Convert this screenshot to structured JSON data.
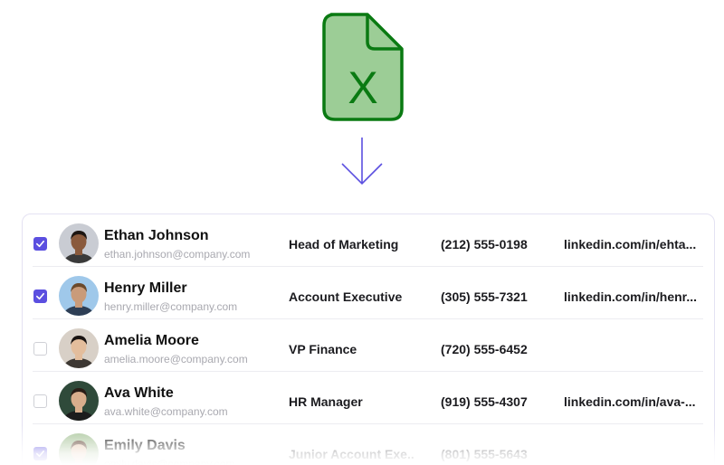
{
  "icons": {
    "file": "excel-file-icon",
    "arrow": "arrow-down-icon",
    "file_letter": "X"
  },
  "colors": {
    "accent": "#5b4fe0",
    "excel_green": "#0a7a12",
    "excel_fill": "#9ccd96"
  },
  "contacts": [
    {
      "checked": true,
      "name": "Ethan Johnson",
      "email": "ethan.johnson@company.com",
      "role": "Head of Marketing",
      "phone": "(212) 555-0198",
      "linkedin": "linkedin.com/in/ehta..."
    },
    {
      "checked": true,
      "name": "Henry Miller",
      "email": "henry.miller@company.com",
      "role": "Account Executive",
      "phone": "(305) 555-7321",
      "linkedin": "linkedin.com/in/henr..."
    },
    {
      "checked": false,
      "name": "Amelia Moore",
      "email": "amelia.moore@company.com",
      "role": "VP Finance",
      "phone": "(720) 555-6452",
      "linkedin": ""
    },
    {
      "checked": false,
      "name": "Ava White",
      "email": "ava.white@company.com",
      "role": "HR Manager",
      "phone": "(919) 555-4307",
      "linkedin": "linkedin.com/in/ava-..."
    },
    {
      "checked": true,
      "name": "Emily Davis",
      "email": "emily.davis@company.com",
      "role": "Junior Account Exe..",
      "phone": "(801) 555-5643",
      "linkedin": ""
    }
  ]
}
